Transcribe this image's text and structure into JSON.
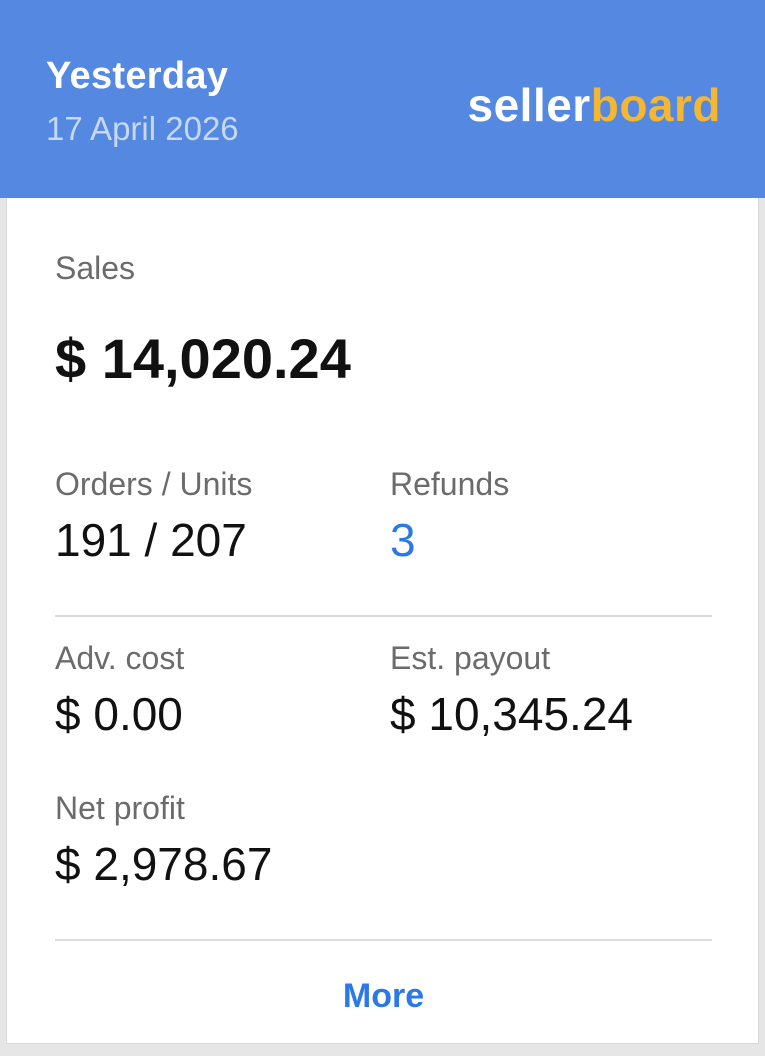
{
  "header": {
    "period_title": "Yesterday",
    "date": "17 April 2026",
    "logo": {
      "part1": "seller",
      "part2": "board",
      "part1_color": "#ffffff",
      "part2_color": "#f5b731"
    },
    "background_color": "#5589e1"
  },
  "metrics": {
    "sales": {
      "label": "Sales",
      "value": "$ 14,020.24"
    },
    "orders_units": {
      "label": "Orders / Units",
      "value": "191 / 207"
    },
    "refunds": {
      "label": "Refunds",
      "value": "3"
    },
    "adv_cost": {
      "label": "Adv. cost",
      "value": "$ 0.00"
    },
    "est_payout": {
      "label": "Est. payout",
      "value": "$ 10,345.24"
    },
    "net_profit": {
      "label": "Net profit",
      "value": "$ 2,978.67"
    }
  },
  "footer": {
    "more_label": "More"
  },
  "colors": {
    "link": "#2b79e6",
    "label": "#6b6b6b",
    "value": "#111111"
  }
}
